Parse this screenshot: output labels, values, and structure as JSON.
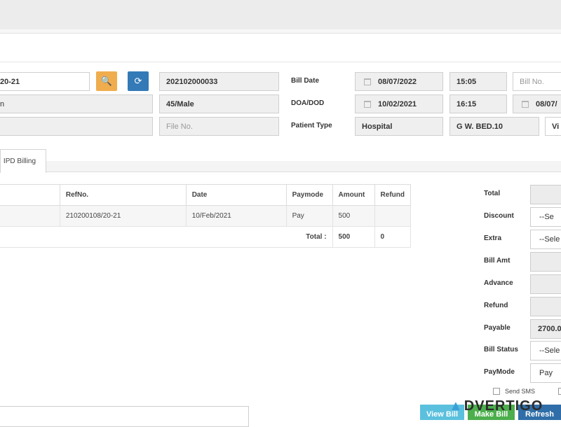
{
  "header": {
    "uhid": "20-21",
    "ip_number": "202102000033",
    "name_partial": "n",
    "age_sex": "45/Male",
    "file_no_placeholder": "File No.",
    "bill_date_label": "Bill Date",
    "bill_date": "08/07/2022",
    "bill_time": "15:05",
    "bill_no_placeholder": "Bill No.",
    "doa_dod_label": "DOA/DOD",
    "doa_date": "10/02/2021",
    "doa_time": "16:15",
    "dod_date": "08/07/",
    "patient_type_label": "Patient Type",
    "patient_type": "Hospital",
    "bed": "G W. BED.10",
    "extra_partial": "Vi"
  },
  "tabs": [
    {
      "label": "IPD Billing"
    }
  ],
  "payments": {
    "columns": [
      "RefNo.",
      "Date",
      "Paymode",
      "Amount",
      "Refund"
    ],
    "rows": [
      {
        "refno": "210200108/20-21",
        "date": "10/Feb/2021",
        "paymode": "Pay",
        "amount": "500",
        "refund": ""
      }
    ],
    "total_label": "Total :",
    "total_amount": "500",
    "total_refund": "0"
  },
  "summary": {
    "total_label": "Total",
    "discount_label": "Discount",
    "discount_value": "--Se",
    "extra_label": "Extra",
    "extra_value": "--Sele",
    "bill_amt_label": "Bill Amt",
    "advance_label": "Advance",
    "refund_label": "Refund",
    "payable_label": "Payable",
    "payable_value": "2700.0",
    "bill_status_label": "Bill Status",
    "bill_status_value": "--Sele",
    "paymode_label": "PayMode",
    "paymode_value": "Pay",
    "send_sms_label": "Send SMS"
  },
  "actions": {
    "view_bill": "View Bill",
    "make_bill": "Make Bill",
    "refresh": "Refresh"
  },
  "watermark": "DVERTIGO",
  "colors": {
    "search_btn": "#f0ad4e",
    "refresh_btn": "#337ab7",
    "view_bill": "#5bc0de",
    "make_bill": "#4cae4c",
    "refresh_action": "#2f6ea8"
  }
}
